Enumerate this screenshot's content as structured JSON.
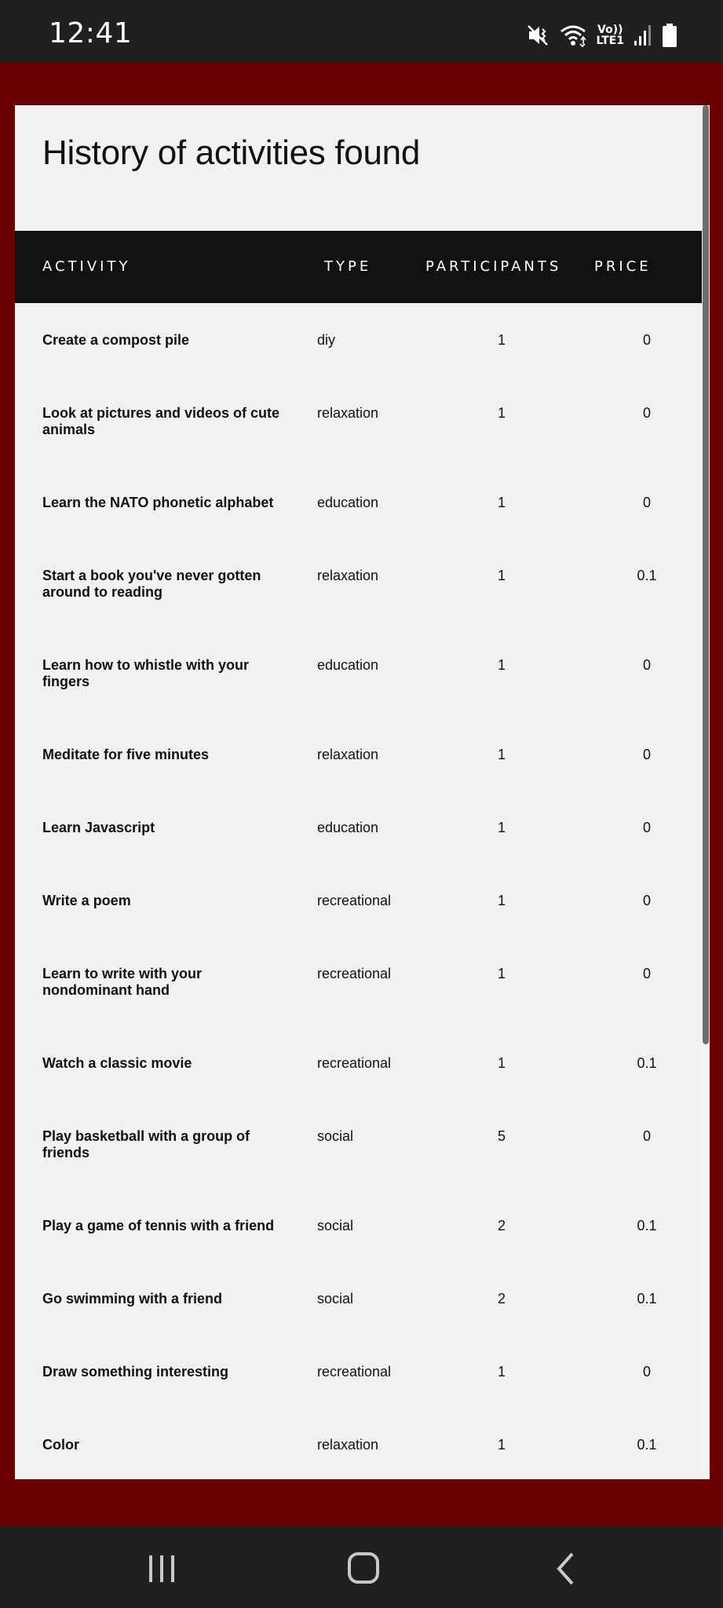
{
  "status_bar": {
    "time": "12:41",
    "volte_line1": "Vo))",
    "volte_line2": "LTE1",
    "icons": [
      "mute-icon",
      "wifi-icon",
      "volte-icon",
      "signal-icon",
      "battery-icon"
    ]
  },
  "page": {
    "title": "History of activities found"
  },
  "table": {
    "headers": {
      "activity": "ACTIVITY",
      "type": "TYPE",
      "participants": "PARTICIPANTS",
      "price": "PRICE"
    },
    "rows": [
      {
        "activity": "Create a compost pile",
        "type": "diy",
        "participants": "1",
        "price": "0"
      },
      {
        "activity": "Look at pictures and videos of cute animals",
        "type": "relaxation",
        "participants": "1",
        "price": "0"
      },
      {
        "activity": "Learn the NATO phonetic alphabet",
        "type": "education",
        "participants": "1",
        "price": "0"
      },
      {
        "activity": "Start a book you've never gotten around to reading",
        "type": "relaxation",
        "participants": "1",
        "price": "0.1"
      },
      {
        "activity": "Learn how to whistle with your fingers",
        "type": "education",
        "participants": "1",
        "price": "0"
      },
      {
        "activity": "Meditate for five minutes",
        "type": "relaxation",
        "participants": "1",
        "price": "0"
      },
      {
        "activity": "Learn Javascript",
        "type": "education",
        "participants": "1",
        "price": "0"
      },
      {
        "activity": "Write a poem",
        "type": "recreational",
        "participants": "1",
        "price": "0"
      },
      {
        "activity": "Learn to write with your nondominant hand",
        "type": "recreational",
        "participants": "1",
        "price": "0"
      },
      {
        "activity": "Watch a classic movie",
        "type": "recreational",
        "participants": "1",
        "price": "0.1"
      },
      {
        "activity": "Play basketball with a group of friends",
        "type": "social",
        "participants": "5",
        "price": "0"
      },
      {
        "activity": "Play a game of tennis with a friend",
        "type": "social",
        "participants": "2",
        "price": "0.1"
      },
      {
        "activity": "Go swimming with a friend",
        "type": "social",
        "participants": "2",
        "price": "0.1"
      },
      {
        "activity": "Draw something interesting",
        "type": "recreational",
        "participants": "1",
        "price": "0"
      },
      {
        "activity": "Color",
        "type": "relaxation",
        "participants": "1",
        "price": "0.1"
      }
    ]
  },
  "nav_bar": {
    "buttons": [
      "recent-apps-icon",
      "home-icon",
      "back-icon"
    ]
  },
  "colors": {
    "background": "#6a0000",
    "card": "#f1f1f1",
    "table_header": "#121212",
    "system_bar": "#202020"
  }
}
